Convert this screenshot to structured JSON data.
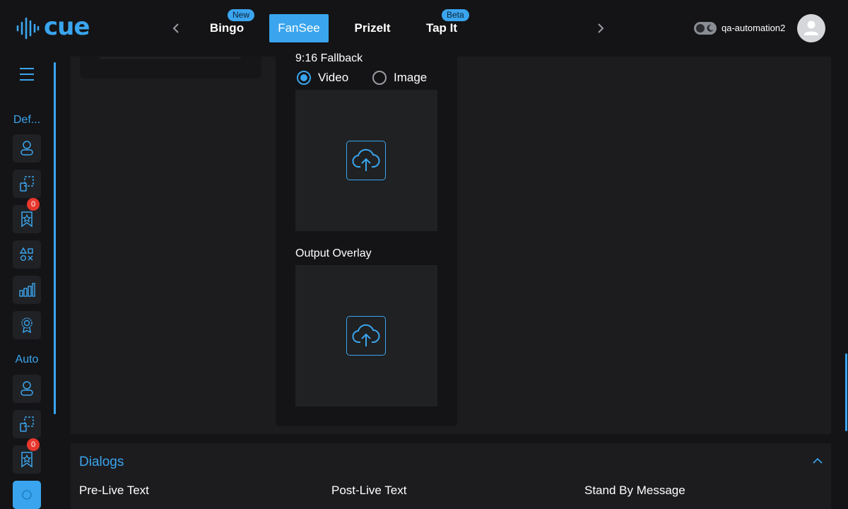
{
  "header": {
    "logo_text": "cue",
    "tabs": [
      {
        "label": "Bingo",
        "badge": "New"
      },
      {
        "label": "FanSee",
        "badge": "",
        "active": true
      },
      {
        "label": "PrizeIt",
        "badge": ""
      },
      {
        "label": "Tap It",
        "badge": "Beta"
      }
    ],
    "username": "qa-automation2"
  },
  "sidebar": {
    "group1_label": "Def...",
    "group2_label": "Auto",
    "notif_count": "0",
    "icons": [
      "user-icon",
      "select-icon",
      "badge-star-icon",
      "shapes-icon",
      "chart-icon",
      "award-icon"
    ]
  },
  "content": {
    "fallback_title": "9:16 Fallback",
    "radio_video": "Video",
    "radio_image": "Image",
    "output_overlay_title": "Output Overlay"
  },
  "dialogs": {
    "title": "Dialogs",
    "pre_live": "Pre-Live Text",
    "post_live": "Post-Live Text",
    "stand_by": "Stand By Message"
  },
  "colors": {
    "accent": "#3aa5ee",
    "background": "#141416",
    "panel": "#1c1c1f",
    "notification": "#e8372e"
  }
}
